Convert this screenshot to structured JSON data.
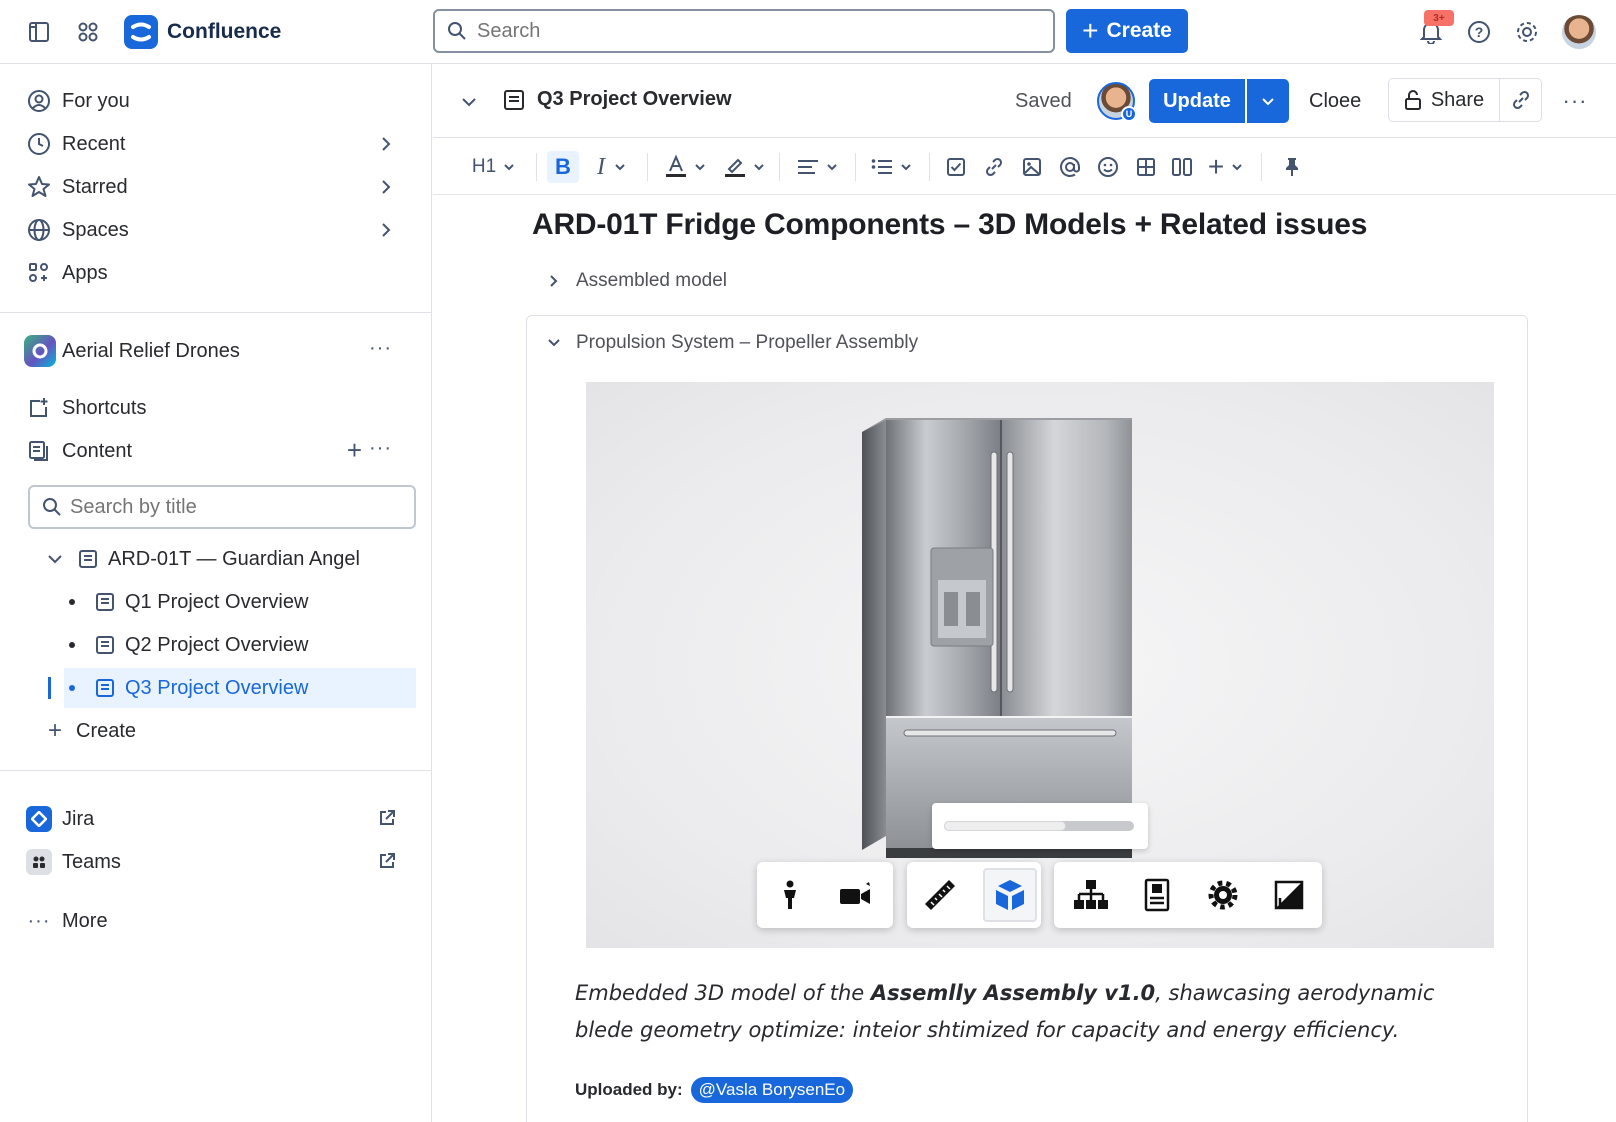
{
  "topnav": {
    "app_name": "Confluence",
    "search_placeholder": "Search",
    "create_label": "Create",
    "notification_badge": "3+"
  },
  "sidebar": {
    "items": [
      {
        "label": "For you"
      },
      {
        "label": "Recent"
      },
      {
        "label": "Starred"
      },
      {
        "label": "Spaces"
      },
      {
        "label": "Apps"
      }
    ],
    "space_name": "Aerial Relief Drones",
    "shortcuts_label": "Shortcuts",
    "content_label": "Content",
    "search_placeholder": "Search by title",
    "tree": {
      "parent": "ARD-01T — Guardian Angel",
      "children": [
        "Q1 Project Overview",
        "Q2 Project Overview",
        "Q3 Project Overview"
      ],
      "selected_index": 2
    },
    "create_label": "Create",
    "apps": [
      {
        "label": "Jira"
      },
      {
        "label": "Teams"
      }
    ],
    "more_label": "More"
  },
  "page": {
    "title": "Q3 Project Overview",
    "saved_label": "Saved",
    "update_label": "Update",
    "close_label": "Cloee",
    "share_label": "Share"
  },
  "toolbar": {
    "heading_label": "H1"
  },
  "content": {
    "heading": "ARD-01T Fridge Components – 3D Models + Related issues",
    "expand_collapsed": "Assembled model",
    "expand_open": "Propulsion System – Propeller Assembly",
    "loading_progress": 0.64,
    "caption_pre": "Embedded 3D model of the ",
    "caption_bold": "Assemlly Assembly v1.0",
    "caption_post": ", shawcasing aerodynamic blede geometry optimize: inteior shtimized for capacity and energy efficiency.",
    "uploaded_label": "Uploaded by:",
    "uploader": "@Vasla BorysenEo"
  },
  "viewer_tools": [
    {
      "icon": "person-icon"
    },
    {
      "icon": "camera-icon"
    },
    {
      "icon": "ruler-icon"
    },
    {
      "icon": "cube-icon",
      "active": true
    },
    {
      "icon": "hierarchy-icon"
    },
    {
      "icon": "properties-icon"
    },
    {
      "icon": "settings-icon"
    },
    {
      "icon": "fullscreen-icon"
    }
  ],
  "colors": {
    "brand": "#1868db",
    "selected_bg": "#e9f2ff",
    "text": "#292a2e"
  }
}
